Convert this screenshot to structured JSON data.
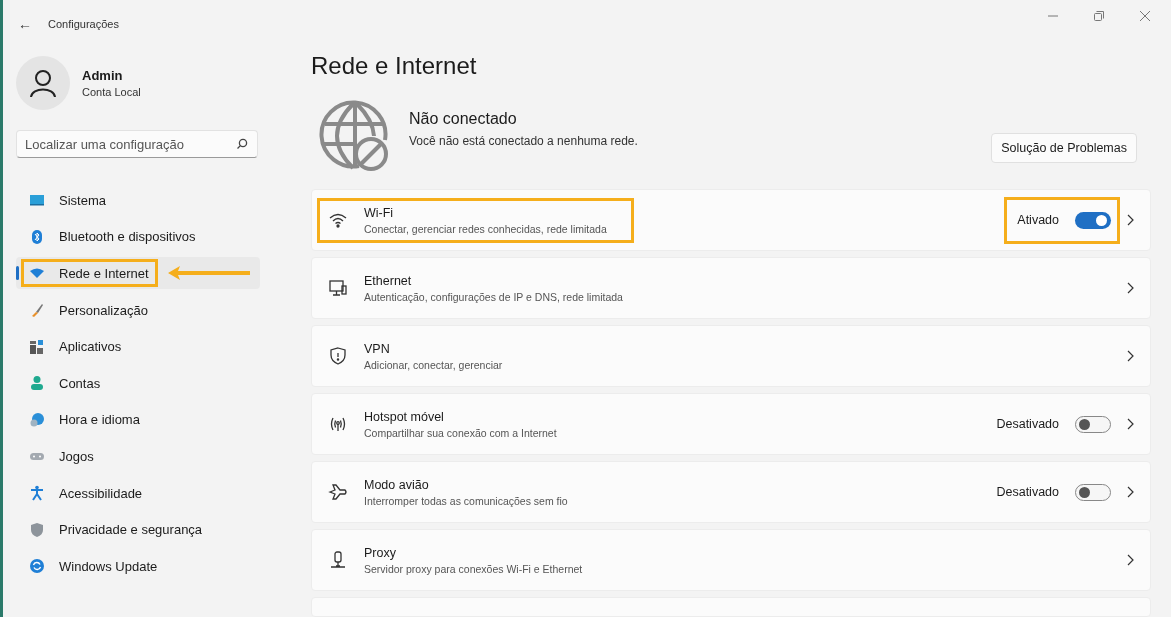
{
  "window": {
    "title": "Configurações",
    "back": "←"
  },
  "account": {
    "name": "Admin",
    "type": "Conta Local"
  },
  "search": {
    "placeholder": "Localizar uma configuração"
  },
  "sidebar": {
    "items": [
      {
        "label": "Sistema",
        "selected": false,
        "highlighted": false
      },
      {
        "label": "Bluetooth e dispositivos",
        "selected": false,
        "highlighted": false
      },
      {
        "label": "Rede e Internet",
        "selected": true,
        "highlighted": true
      },
      {
        "label": "Personalização",
        "selected": false,
        "highlighted": false
      },
      {
        "label": "Aplicativos",
        "selected": false,
        "highlighted": false
      },
      {
        "label": "Contas",
        "selected": false,
        "highlighted": false
      },
      {
        "label": "Hora e idioma",
        "selected": false,
        "highlighted": false
      },
      {
        "label": "Jogos",
        "selected": false,
        "highlighted": false
      },
      {
        "label": "Acessibilidade",
        "selected": false,
        "highlighted": false
      },
      {
        "label": "Privacidade e segurança",
        "selected": false,
        "highlighted": false
      },
      {
        "label": "Windows Update",
        "selected": false,
        "highlighted": false
      }
    ]
  },
  "page": {
    "title": "Rede e Internet"
  },
  "status": {
    "title": "Não conectado",
    "description": "Você não está conectado a nenhuma rede.",
    "button": "Solução de Problemas"
  },
  "settings": [
    {
      "kind": "toggle",
      "title": "Wi-Fi",
      "description": "Conectar, gerenciar redes conhecidas, rede limitada",
      "state_label": "Ativado",
      "on": true,
      "highlighted": true
    },
    {
      "kind": "link",
      "title": "Ethernet",
      "description": "Autenticação, configurações de IP e DNS, rede limitada",
      "highlighted": false
    },
    {
      "kind": "link",
      "title": "VPN",
      "description": "Adicionar, conectar, gerenciar",
      "highlighted": false
    },
    {
      "kind": "toggle",
      "title": "Hotspot móvel",
      "description": "Compartilhar sua conexão com a Internet",
      "state_label": "Desativado",
      "on": false,
      "highlighted": false
    },
    {
      "kind": "toggle",
      "title": "Modo avião",
      "description": "Interromper todas as comunicações sem fio",
      "state_label": "Desativado",
      "on": false,
      "highlighted": false
    },
    {
      "kind": "link",
      "title": "Proxy",
      "description": "Servidor proxy para conexões Wi-Fi e Ethernet",
      "highlighted": false
    }
  ]
}
